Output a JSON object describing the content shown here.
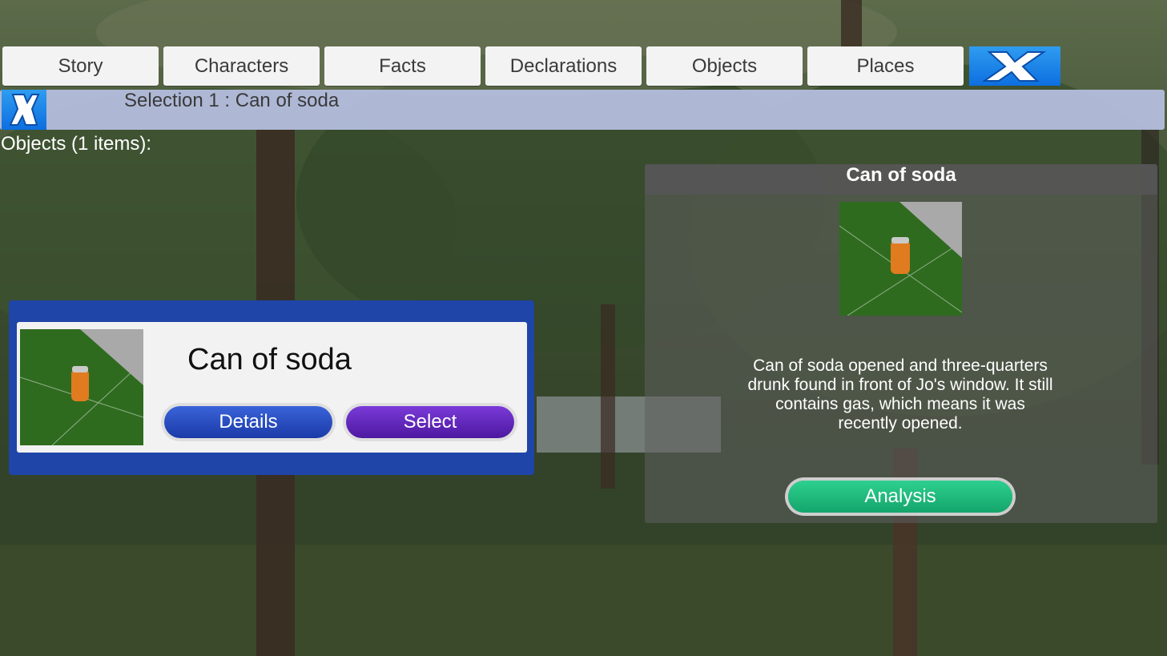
{
  "tabs": [
    {
      "label": "Story"
    },
    {
      "label": "Characters"
    },
    {
      "label": "Facts"
    },
    {
      "label": "Declarations"
    },
    {
      "label": "Objects"
    },
    {
      "label": "Places"
    }
  ],
  "close_icon": "x-icon",
  "selection": {
    "text": "Selection 1 : Can of soda"
  },
  "objects_header": "Objects (1 items):",
  "card": {
    "name": "Can of soda",
    "details_label": "Details",
    "select_label": "Select"
  },
  "detail": {
    "title": "Can of soda",
    "description": "Can of soda opened and three-quarters drunk found in front of Jo's window. It still contains gas, which means it was recently opened.",
    "analysis_label": "Analysis"
  },
  "colors": {
    "details_button": "#2146b8",
    "select_button": "#5e1fb3",
    "analysis_button": "#19b97b",
    "card_frame": "#1f45a8",
    "close_button": "#1a7fe8"
  }
}
